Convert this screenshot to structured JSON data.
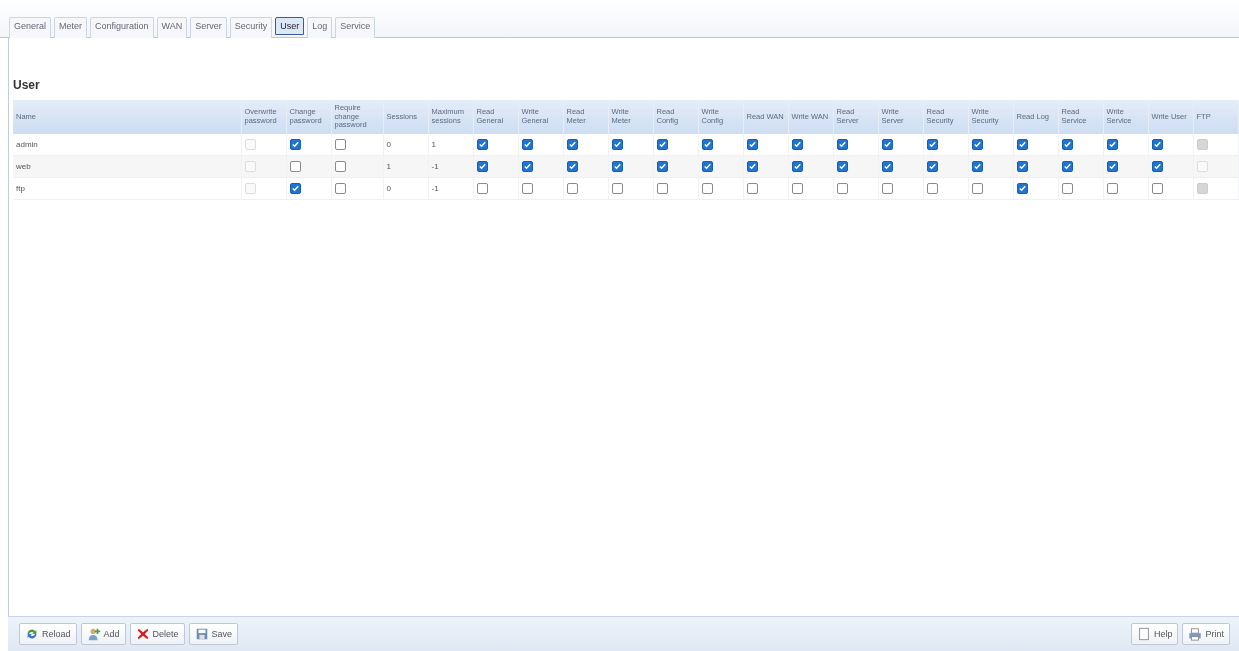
{
  "tabs": [
    {
      "label": "General",
      "selected": false
    },
    {
      "label": "Meter",
      "selected": false
    },
    {
      "label": "Configuration",
      "selected": false
    },
    {
      "label": "WAN",
      "selected": false
    },
    {
      "label": "Server",
      "selected": false
    },
    {
      "label": "Security",
      "selected": false
    },
    {
      "label": "User",
      "selected": true
    },
    {
      "label": "Log",
      "selected": false
    },
    {
      "label": "Service",
      "selected": false
    }
  ],
  "section_title": "User",
  "table": {
    "columns": [
      {
        "label": "Name",
        "kind": "text"
      },
      {
        "label": "Overwrite password",
        "kind": "check"
      },
      {
        "label": "Change password",
        "kind": "check"
      },
      {
        "label": "Require change password",
        "kind": "check"
      },
      {
        "label": "Sessions",
        "kind": "text"
      },
      {
        "label": "Maximum sessions",
        "kind": "text"
      },
      {
        "label": "Read General",
        "kind": "check"
      },
      {
        "label": "Write General",
        "kind": "check"
      },
      {
        "label": "Read Meter",
        "kind": "check"
      },
      {
        "label": "Write Meter",
        "kind": "check"
      },
      {
        "label": "Read Config",
        "kind": "check"
      },
      {
        "label": "Write Config",
        "kind": "check"
      },
      {
        "label": "Read WAN",
        "kind": "check"
      },
      {
        "label": "Write WAN",
        "kind": "check"
      },
      {
        "label": "Read Server",
        "kind": "check"
      },
      {
        "label": "Write Server",
        "kind": "check"
      },
      {
        "label": "Read Security",
        "kind": "check"
      },
      {
        "label": "Write Security",
        "kind": "check"
      },
      {
        "label": "Read Log",
        "kind": "check"
      },
      {
        "label": "Read Service",
        "kind": "check"
      },
      {
        "label": "Write Service",
        "kind": "check"
      },
      {
        "label": "Write User",
        "kind": "check"
      },
      {
        "label": "FTP",
        "kind": "check"
      }
    ],
    "rows": [
      {
        "cells": [
          {
            "text": "admin"
          },
          {
            "checked": false,
            "disabled": true
          },
          {
            "checked": true,
            "disabled": false
          },
          {
            "checked": false,
            "disabled": false
          },
          {
            "text": "0"
          },
          {
            "text": "1"
          },
          {
            "checked": true,
            "disabled": false
          },
          {
            "checked": true,
            "disabled": false
          },
          {
            "checked": true,
            "disabled": false
          },
          {
            "checked": true,
            "disabled": false
          },
          {
            "checked": true,
            "disabled": false
          },
          {
            "checked": true,
            "disabled": false
          },
          {
            "checked": true,
            "disabled": false
          },
          {
            "checked": true,
            "disabled": false
          },
          {
            "checked": true,
            "disabled": false
          },
          {
            "checked": true,
            "disabled": false
          },
          {
            "checked": true,
            "disabled": false
          },
          {
            "checked": true,
            "disabled": false
          },
          {
            "checked": true,
            "disabled": false
          },
          {
            "checked": true,
            "disabled": false
          },
          {
            "checked": true,
            "disabled": false
          },
          {
            "checked": true,
            "disabled": false
          },
          {
            "checked": true,
            "disabled": true
          }
        ]
      },
      {
        "cells": [
          {
            "text": "web"
          },
          {
            "checked": false,
            "disabled": true
          },
          {
            "checked": false,
            "disabled": false
          },
          {
            "checked": false,
            "disabled": false
          },
          {
            "text": "1"
          },
          {
            "text": "-1"
          },
          {
            "checked": true,
            "disabled": false
          },
          {
            "checked": true,
            "disabled": false
          },
          {
            "checked": true,
            "disabled": false
          },
          {
            "checked": true,
            "disabled": false
          },
          {
            "checked": true,
            "disabled": false
          },
          {
            "checked": true,
            "disabled": false
          },
          {
            "checked": true,
            "disabled": false
          },
          {
            "checked": true,
            "disabled": false
          },
          {
            "checked": true,
            "disabled": false
          },
          {
            "checked": true,
            "disabled": false
          },
          {
            "checked": true,
            "disabled": false
          },
          {
            "checked": true,
            "disabled": false
          },
          {
            "checked": true,
            "disabled": false
          },
          {
            "checked": true,
            "disabled": false
          },
          {
            "checked": true,
            "disabled": false
          },
          {
            "checked": true,
            "disabled": false
          },
          {
            "checked": false,
            "disabled": true
          }
        ]
      },
      {
        "cells": [
          {
            "text": "ftp"
          },
          {
            "checked": false,
            "disabled": true
          },
          {
            "checked": true,
            "disabled": false
          },
          {
            "checked": false,
            "disabled": false
          },
          {
            "text": "0"
          },
          {
            "text": "-1"
          },
          {
            "checked": false,
            "disabled": false
          },
          {
            "checked": false,
            "disabled": false
          },
          {
            "checked": false,
            "disabled": false
          },
          {
            "checked": false,
            "disabled": false
          },
          {
            "checked": false,
            "disabled": false
          },
          {
            "checked": false,
            "disabled": false
          },
          {
            "checked": false,
            "disabled": false
          },
          {
            "checked": false,
            "disabled": false
          },
          {
            "checked": false,
            "disabled": false
          },
          {
            "checked": false,
            "disabled": false
          },
          {
            "checked": false,
            "disabled": false
          },
          {
            "checked": false,
            "disabled": false
          },
          {
            "checked": true,
            "disabled": false
          },
          {
            "checked": false,
            "disabled": false
          },
          {
            "checked": false,
            "disabled": false
          },
          {
            "checked": false,
            "disabled": false
          },
          {
            "checked": true,
            "disabled": true
          }
        ]
      }
    ]
  },
  "toolbar_left": [
    {
      "label": "Reload",
      "kind": "reload"
    },
    {
      "label": "Add",
      "kind": "add"
    },
    {
      "label": "Delete",
      "kind": "delete"
    },
    {
      "label": "Save",
      "kind": "save"
    }
  ],
  "toolbar_right": [
    {
      "label": "Help",
      "kind": "help"
    },
    {
      "label": "Print",
      "kind": "print"
    }
  ]
}
